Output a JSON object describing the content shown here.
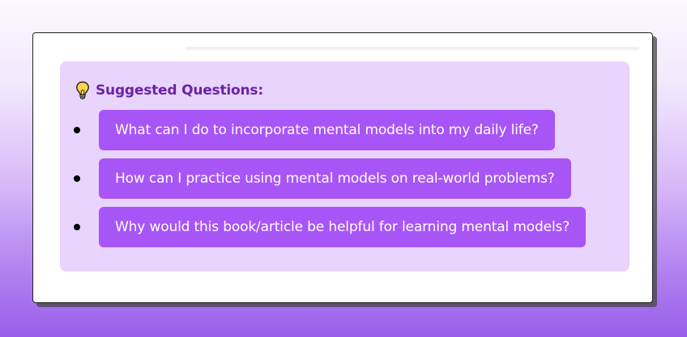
{
  "panel": {
    "heading_label": "Suggested Questions:",
    "heading_icon": "lightbulb-icon",
    "questions": [
      "What can I do to incorporate mental models into my daily life?",
      "How can I practice using mental models on real-world problems?",
      "Why would this book/article be helpful for learning mental models?"
    ]
  },
  "colors": {
    "panel_background": "#e8d4fd",
    "heading_text": "#6a23a6",
    "question_button": "#a855f7",
    "question_text": "#ffffff",
    "page_gradient_bottom": "#9a5de9"
  }
}
